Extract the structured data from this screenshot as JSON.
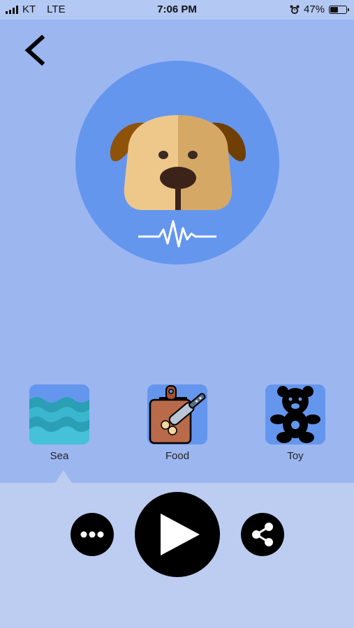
{
  "status_bar": {
    "carrier": "KT",
    "network": "LTE",
    "time": "7:06 PM",
    "battery": "47%"
  },
  "icons": {
    "back": "chevron-left-icon",
    "main_sound": "dog-face-icon",
    "waveform": "sound-wave-icon",
    "more": "more-dots-icon",
    "play": "play-icon",
    "share": "share-icon"
  },
  "categories": [
    {
      "label": "Sea",
      "icon": "sea-waves-icon",
      "selected": true
    },
    {
      "label": "Food",
      "icon": "cutting-board-knife-icon",
      "selected": false
    },
    {
      "label": "Toy",
      "icon": "teddy-bear-icon",
      "selected": false
    }
  ],
  "colors": {
    "background": "#9cb6f0",
    "circle": "#6596ee",
    "panel": "#bccdf1",
    "button": "#000000"
  }
}
